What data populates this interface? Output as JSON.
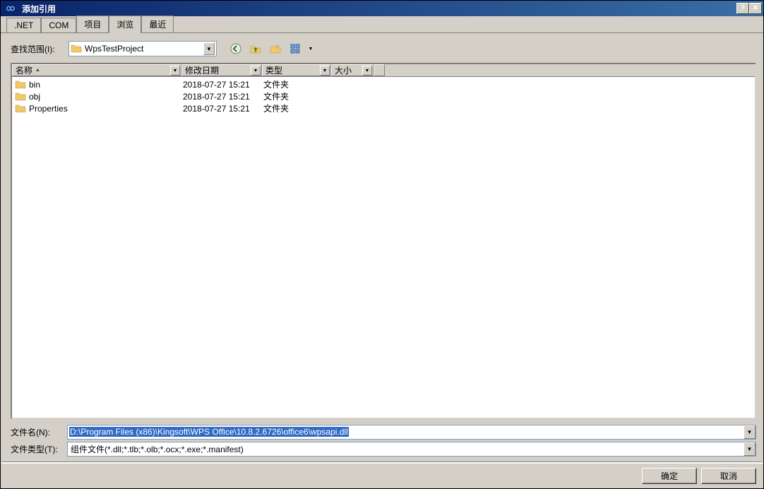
{
  "title": "添加引用",
  "tabs": [
    {
      "label": ".NET"
    },
    {
      "label": "COM"
    },
    {
      "label": "项目"
    },
    {
      "label": "浏览",
      "active": true
    },
    {
      "label": "最近"
    }
  ],
  "lookin": {
    "label": "查找范围(I):",
    "value": "WpsTestProject"
  },
  "columns": {
    "name": "名称",
    "date": "修改日期",
    "type": "类型",
    "size": "大小"
  },
  "rows": [
    {
      "name": "bin",
      "date": "2018-07-27 15:21",
      "type": "文件夹"
    },
    {
      "name": "obj",
      "date": "2018-07-27 15:21",
      "type": "文件夹"
    },
    {
      "name": "Properties",
      "date": "2018-07-27 15:21",
      "type": "文件夹"
    }
  ],
  "filename": {
    "label": "文件名(N):",
    "value": "D:\\Program Files (x86)\\Kingsoft\\WPS Office\\10.8.2.6726\\office6\\wpsapi.dll"
  },
  "filetype": {
    "label": "文件类型(T):",
    "value": "组件文件(*.dll;*.tlb;*.olb;*.ocx;*.exe;*.manifest)"
  },
  "buttons": {
    "ok": "确定",
    "cancel": "取消"
  },
  "icons": {
    "app": "infinity-icon",
    "back": "back-icon",
    "up": "up-icon",
    "newfolder": "new-folder-icon",
    "views": "views-icon",
    "help": "help-icon",
    "close": "close-icon"
  }
}
